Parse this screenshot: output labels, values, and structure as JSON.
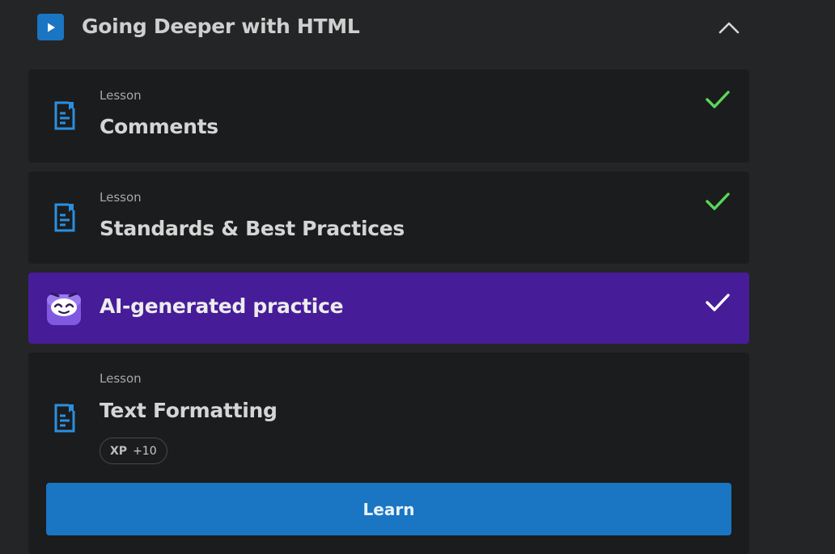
{
  "section": {
    "title": "Going Deeper with HTML",
    "icon": "play-icon",
    "collapse_icon": "chevron-up-icon",
    "accent": "#1a75c2"
  },
  "items": [
    {
      "kicker": "Lesson",
      "title": "Comments",
      "icon": "document-icon",
      "status": "completed",
      "status_color": "#5ad65a"
    },
    {
      "kicker": "Lesson",
      "title": "Standards & Best Practices",
      "icon": "document-icon",
      "status": "completed",
      "status_color": "#5ad65a"
    },
    {
      "title": "AI-generated practice",
      "icon": "ai-mascot-icon",
      "status": "completed",
      "background": "#461c98"
    },
    {
      "kicker": "Lesson",
      "title": "Text Formatting",
      "icon": "document-icon",
      "xp_label": "XP",
      "xp_value": "+10",
      "button_label": "Learn"
    }
  ]
}
